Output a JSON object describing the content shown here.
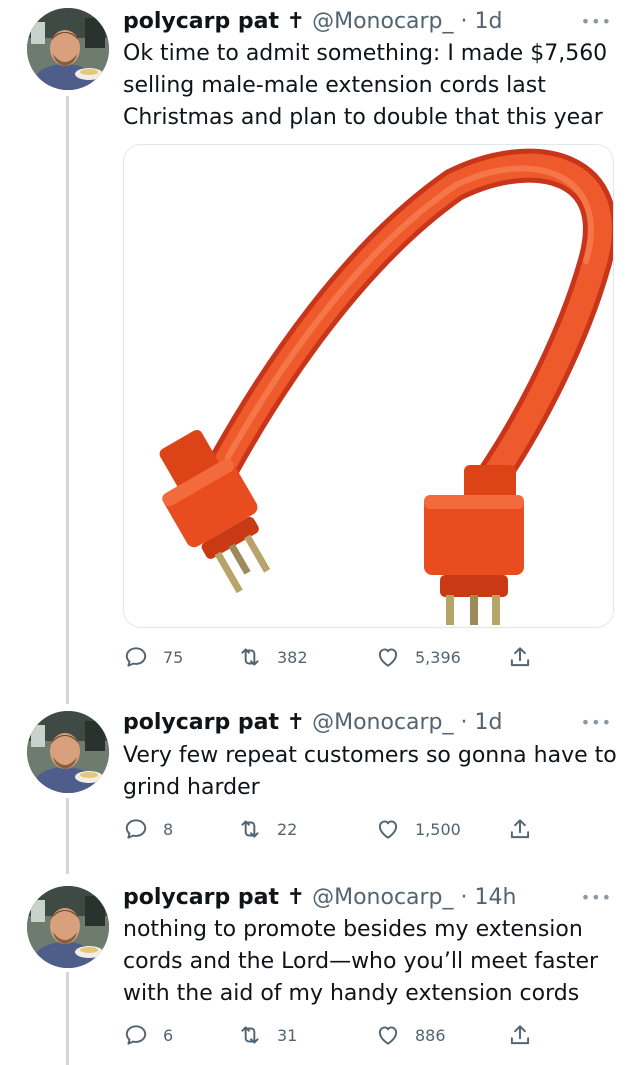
{
  "tweets": [
    {
      "name": "polycarp pat ✝",
      "handle": "@Monocarp_",
      "separator": "·",
      "time": "1d",
      "text": "Ok time to admit something: I made $7,560 selling male-male extension cords last Christmas and plan to double that this year",
      "replies": "75",
      "retweets": "382",
      "likes": "5,396"
    },
    {
      "name": "polycarp pat ✝",
      "handle": "@Monocarp_",
      "separator": "·",
      "time": "1d",
      "text": "Very few repeat customers so gonna have to grind harder",
      "replies": "8",
      "retweets": "22",
      "likes": "1,500"
    },
    {
      "name": "polycarp pat ✝",
      "handle": "@Monocarp_",
      "separator": "·",
      "time": "14h",
      "text": "nothing to promote besides my extension cords and the Lord—who you’ll meet faster with the aid of my handy extension cords",
      "replies": "6",
      "retweets": "31",
      "likes": "886"
    }
  ],
  "more_label": "•••",
  "colors": {
    "cord": "#e8481d",
    "text": "#0f1419",
    "secondary": "#536471",
    "thread_line": "#cfd9de"
  }
}
